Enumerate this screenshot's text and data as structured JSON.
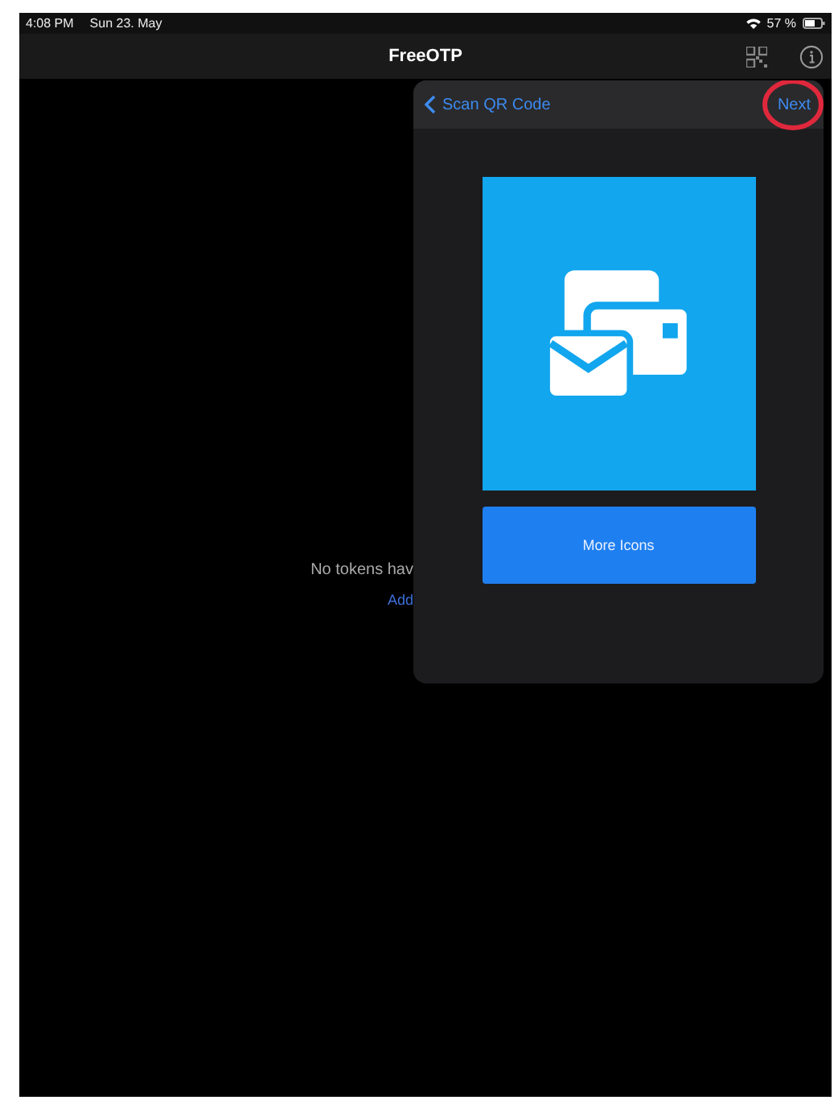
{
  "status_bar": {
    "time": "4:08 PM",
    "date": "Sun 23. May",
    "battery_text": "57 %"
  },
  "nav_bar": {
    "title": "FreeOTP"
  },
  "empty_state": {
    "message": "No tokens hav",
    "link": "Add"
  },
  "popover": {
    "back": "Scan QR Code",
    "next": "Next",
    "next_highlighted": true,
    "image": {
      "kind": "icon"
    },
    "button": "More Icons"
  }
}
